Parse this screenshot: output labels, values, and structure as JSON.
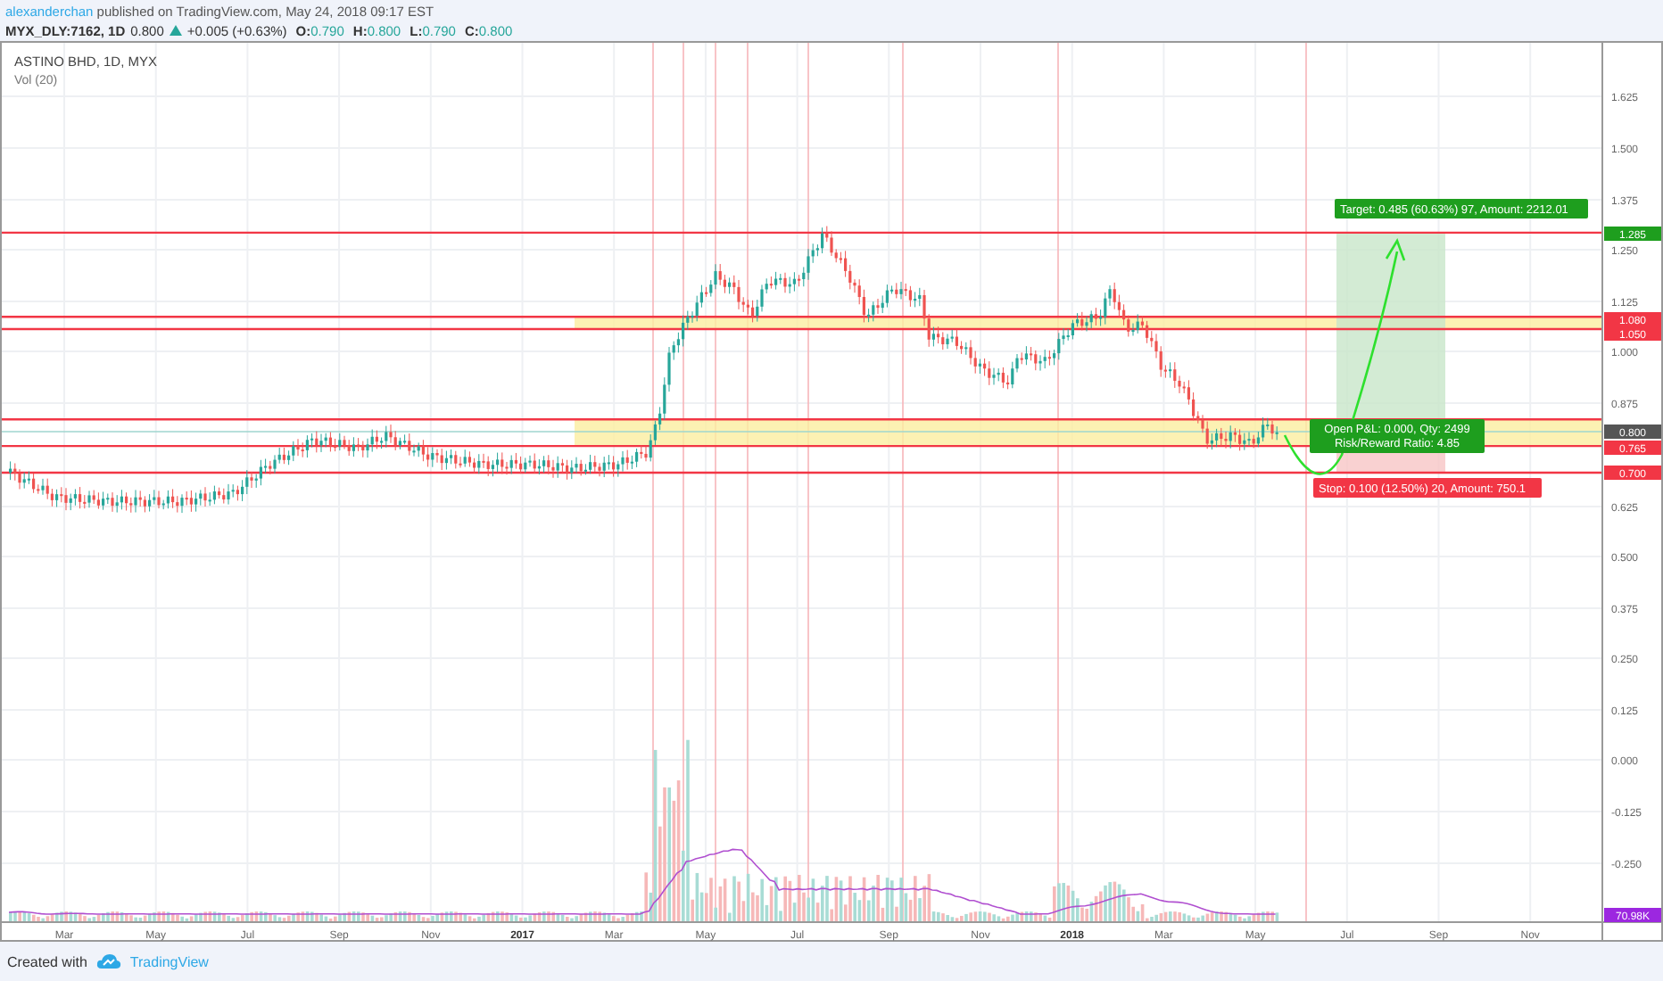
{
  "header": {
    "author": "alexanderchan",
    "published": "published on TradingView.com, May 24, 2018 09:17 EST"
  },
  "symbol_line": {
    "symbol": "MYX_DLY:7162, 1D",
    "price": "0.800",
    "change": "+0.005 (+0.63%)",
    "ohlc": [
      {
        "label": "O:",
        "value": "0.790"
      },
      {
        "label": "H:",
        "value": "0.800"
      },
      {
        "label": "L:",
        "value": "0.790"
      },
      {
        "label": "C:",
        "value": "0.800"
      }
    ]
  },
  "chart": {
    "title": "ASTINO BHD, 1D, MYX",
    "indicator": "Vol (20)",
    "price_axis": [
      "1.625",
      "1.500",
      "1.375",
      "1.250",
      "1.125",
      "1.000",
      "0.875",
      "0.625",
      "0.500",
      "0.375",
      "0.250",
      "0.125",
      "0.000",
      "-0.125",
      "-0.250"
    ],
    "price_badges": [
      {
        "label": "1.285",
        "color": "#1e9e1e"
      },
      {
        "label": "1.080",
        "color": "#f23645"
      },
      {
        "label": "1.050",
        "color": "#f23645"
      },
      {
        "label": "0.800",
        "color": "#555555"
      },
      {
        "label": "0.765",
        "color": "#f23645"
      },
      {
        "label": "0.700",
        "color": "#f23645"
      },
      {
        "label": "70.98K",
        "color": "#9c27e0"
      }
    ],
    "time_axis": [
      {
        "label": "Mar",
        "kind": "month"
      },
      {
        "label": "May",
        "kind": "month"
      },
      {
        "label": "Jul",
        "kind": "month"
      },
      {
        "label": "Sep",
        "kind": "month"
      },
      {
        "label": "Nov",
        "kind": "month"
      },
      {
        "label": "2017",
        "kind": "year"
      },
      {
        "label": "Mar",
        "kind": "month"
      },
      {
        "label": "May",
        "kind": "month"
      },
      {
        "label": "Jul",
        "kind": "month"
      },
      {
        "label": "Sep",
        "kind": "month"
      },
      {
        "label": "Nov",
        "kind": "month"
      },
      {
        "label": "2018",
        "kind": "year"
      },
      {
        "label": "Mar",
        "kind": "month"
      },
      {
        "label": "May",
        "kind": "month"
      },
      {
        "label": "Jul",
        "kind": "month"
      },
      {
        "label": "Sep",
        "kind": "month"
      },
      {
        "label": "Nov",
        "kind": "month"
      }
    ],
    "target_label": "Target: 0.485 (60.63%) 97, Amount: 2212.01",
    "position_label": [
      "Open P&L: 0.000, Qty: 2499",
      "Risk/Reward Ratio: 4.85"
    ],
    "stop_label": "Stop: 0.100 (12.50%) 20, Amount: 750.1"
  },
  "footer": {
    "created": "Created with",
    "brand": "TradingView"
  }
}
